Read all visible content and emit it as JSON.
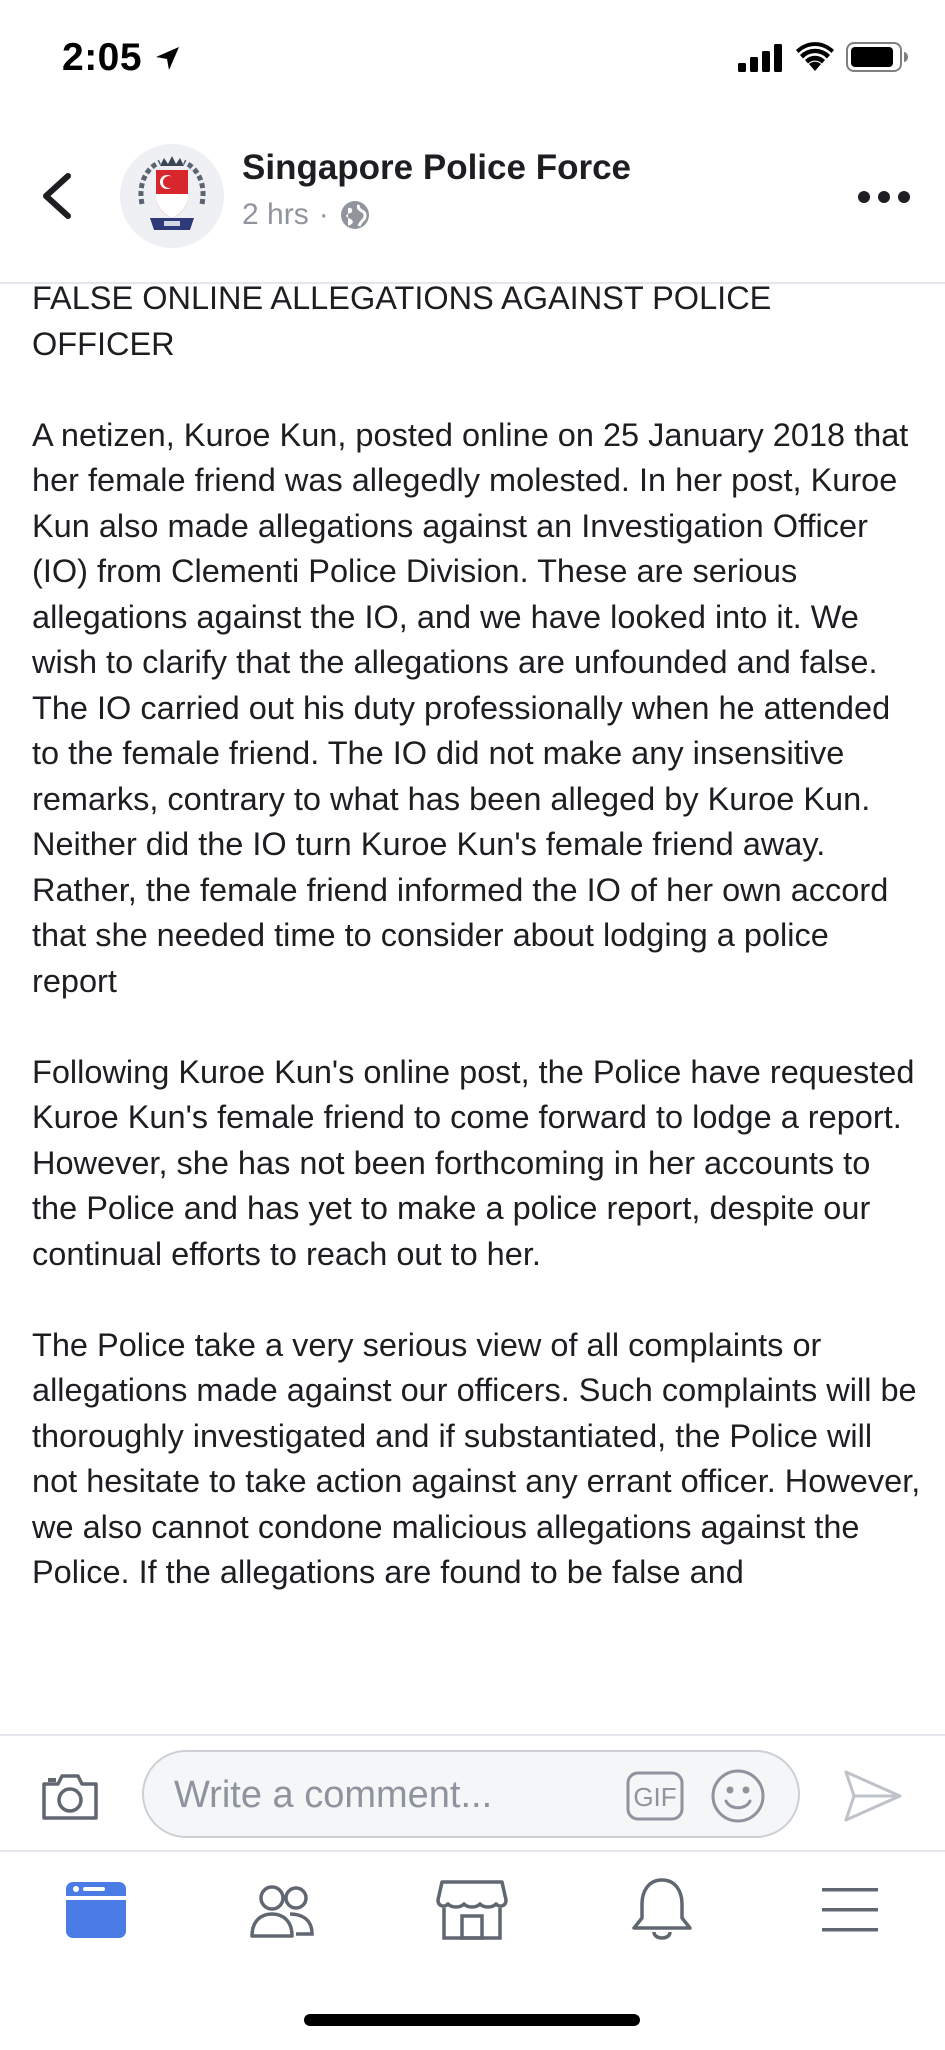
{
  "status_bar": {
    "time": "2:05",
    "icons": [
      "location-arrow-icon",
      "cellular-signal-icon",
      "wifi-icon",
      "battery-icon"
    ]
  },
  "post": {
    "page_name": "Singapore Police Force",
    "timestamp": "2 hrs",
    "separator": "·",
    "privacy_icon": "globe-icon",
    "paragraphs": [
      "FALSE ONLINE ALLEGATIONS AGAINST POLICE OFFICER",
      "A netizen, Kuroe Kun, posted online on 25 January 2018 that her female friend was allegedly molested. In her post, Kuroe Kun also made allegations against an Investigation Officer (IO) from Clementi Police Division. These are serious allegations against the IO, and we have looked into it. We wish to clarify that the allegations are unfounded and false. The IO carried out his duty professionally when he attended to the female friend. The IO did not make any insensitive remarks, contrary to what has been alleged by Kuroe Kun. Neither did the IO turn Kuroe Kun's female friend away. Rather, the female friend informed the IO of her own accord that she needed time to consider about lodging a police report",
      "Following Kuroe Kun's online post, the Police have requested Kuroe Kun's female friend to come forward to lodge a report. However, she has not been forthcoming in her accounts to the Police and has yet to make a police report, despite our continual efforts to reach out to her.",
      "The Police take a very serious view of all complaints or allegations made against our officers. Such complaints will be thoroughly investigated and if substantiated, the Police will not hesitate to take action against any errant officer. However, we also cannot condone malicious allegations against the Police. If the allegations are found to be false and"
    ]
  },
  "comment_bar": {
    "placeholder": "Write a comment...",
    "gif_label": "GIF"
  },
  "bottom_nav": {
    "items": [
      "news-feed-icon",
      "friends-icon",
      "marketplace-icon",
      "notifications-icon",
      "menu-icon"
    ],
    "active": "news-feed-icon"
  },
  "colors": {
    "accent": "#4b7be5",
    "icon_gray": "#606770",
    "text": "#1c1e21",
    "meta_text": "#90949c"
  }
}
